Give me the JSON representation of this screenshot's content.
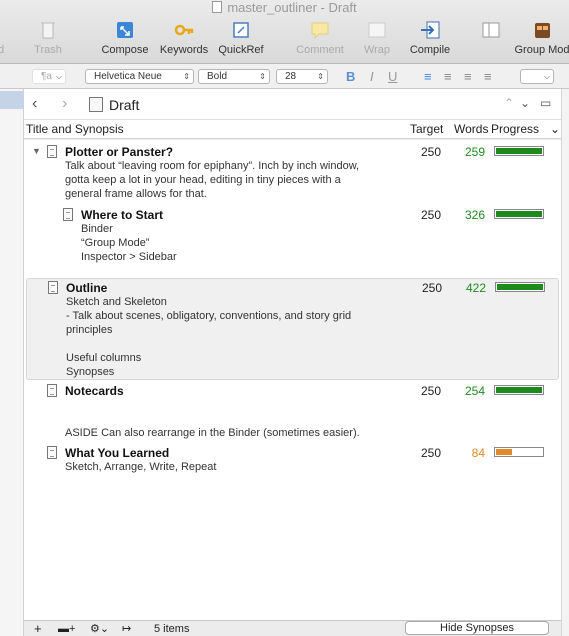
{
  "window": {
    "title": "master_outliner - Draft"
  },
  "toolbar": {
    "items": [
      {
        "label": "d",
        "icon": "partial-icon"
      },
      {
        "label": "Trash",
        "icon": "trash-icon"
      },
      {
        "label": "Compose",
        "icon": "compose-icon"
      },
      {
        "label": "Keywords",
        "icon": "keywords-icon"
      },
      {
        "label": "QuickRef",
        "icon": "quickref-icon"
      },
      {
        "label": "Comment",
        "icon": "comment-icon"
      },
      {
        "label": "Wrap",
        "icon": "wrap-icon"
      },
      {
        "label": "Compile",
        "icon": "compile-icon"
      },
      {
        "label": "Group Mod",
        "icon": "group-mode-icon"
      }
    ]
  },
  "format": {
    "style": "¶a",
    "font": "Helvetica Neue",
    "weight": "Bold",
    "size": "28"
  },
  "editor": {
    "doc_name": "Draft"
  },
  "columns": {
    "title": "Title and Synopsis",
    "target": "Target",
    "words": "Words",
    "progress": "Progress"
  },
  "rows": [
    {
      "title": "Plotter or Panster?",
      "synopsis": "Talk about “leaving room for epiphany”. Inch by inch window,\ngotta keep a lot in your head, editing in tiny pieces with a\ngeneral frame allows for that.",
      "target": "250",
      "words": "259",
      "progress": 1.0
    },
    {
      "title": "Where to Start",
      "synopsis": "Binder\n“Group Mode”\nInspector > Sidebar",
      "target": "250",
      "words": "326",
      "progress": 1.0
    },
    {
      "title": "Outline",
      "synopsis": "Sketch and Skeleton\n- Talk about scenes, obligatory, conventions, and story grid\nprinciples\n\nUseful columns\nSynopses",
      "target": "250",
      "words": "422",
      "progress": 1.0
    },
    {
      "title": "Notecards",
      "synopsis": "\n\nASIDE Can also rearrange in the Binder (sometimes easier).",
      "target": "250",
      "words": "254",
      "progress": 1.0
    },
    {
      "title": "What You Learned",
      "synopsis": "Sketch, Arrange, Write, Repeat",
      "target": "250",
      "words": "84",
      "progress": 0.34
    }
  ],
  "colors": {
    "complete": "#1e8a1e",
    "partial": "#e28a2a"
  },
  "footer": {
    "count": "5 items",
    "hide_synopses": "Hide Synopses"
  }
}
